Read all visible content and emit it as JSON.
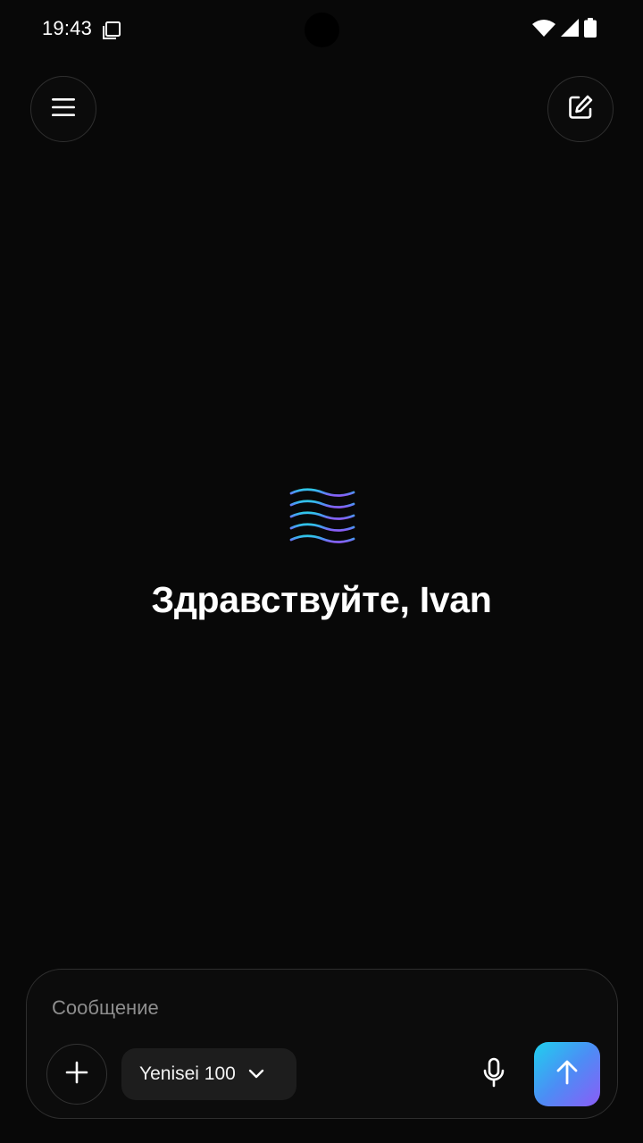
{
  "status_bar": {
    "time": "19:43",
    "icons": [
      "screenshot-icon",
      "wifi-icon",
      "signal-icon",
      "battery-icon"
    ]
  },
  "header": {
    "menu_icon": "hamburger-icon",
    "compose_icon": "edit-icon"
  },
  "main": {
    "logo_icon": "waves-logo-icon",
    "greeting": "Здравствуйте, Ivan"
  },
  "composer": {
    "placeholder": "Сообщение",
    "value": "",
    "attach_icon": "plus-icon",
    "model_label": "Yenisei 100",
    "model_icon": "chevron-down-icon",
    "mic_icon": "microphone-icon",
    "send_icon": "arrow-up-icon"
  },
  "colors": {
    "background": "#080808",
    "send_gradient": [
      "#1fd0ee",
      "#4c8df5",
      "#8b5cf6"
    ],
    "logo_gradient": [
      "#2ec8e8",
      "#8b5cf6"
    ]
  }
}
